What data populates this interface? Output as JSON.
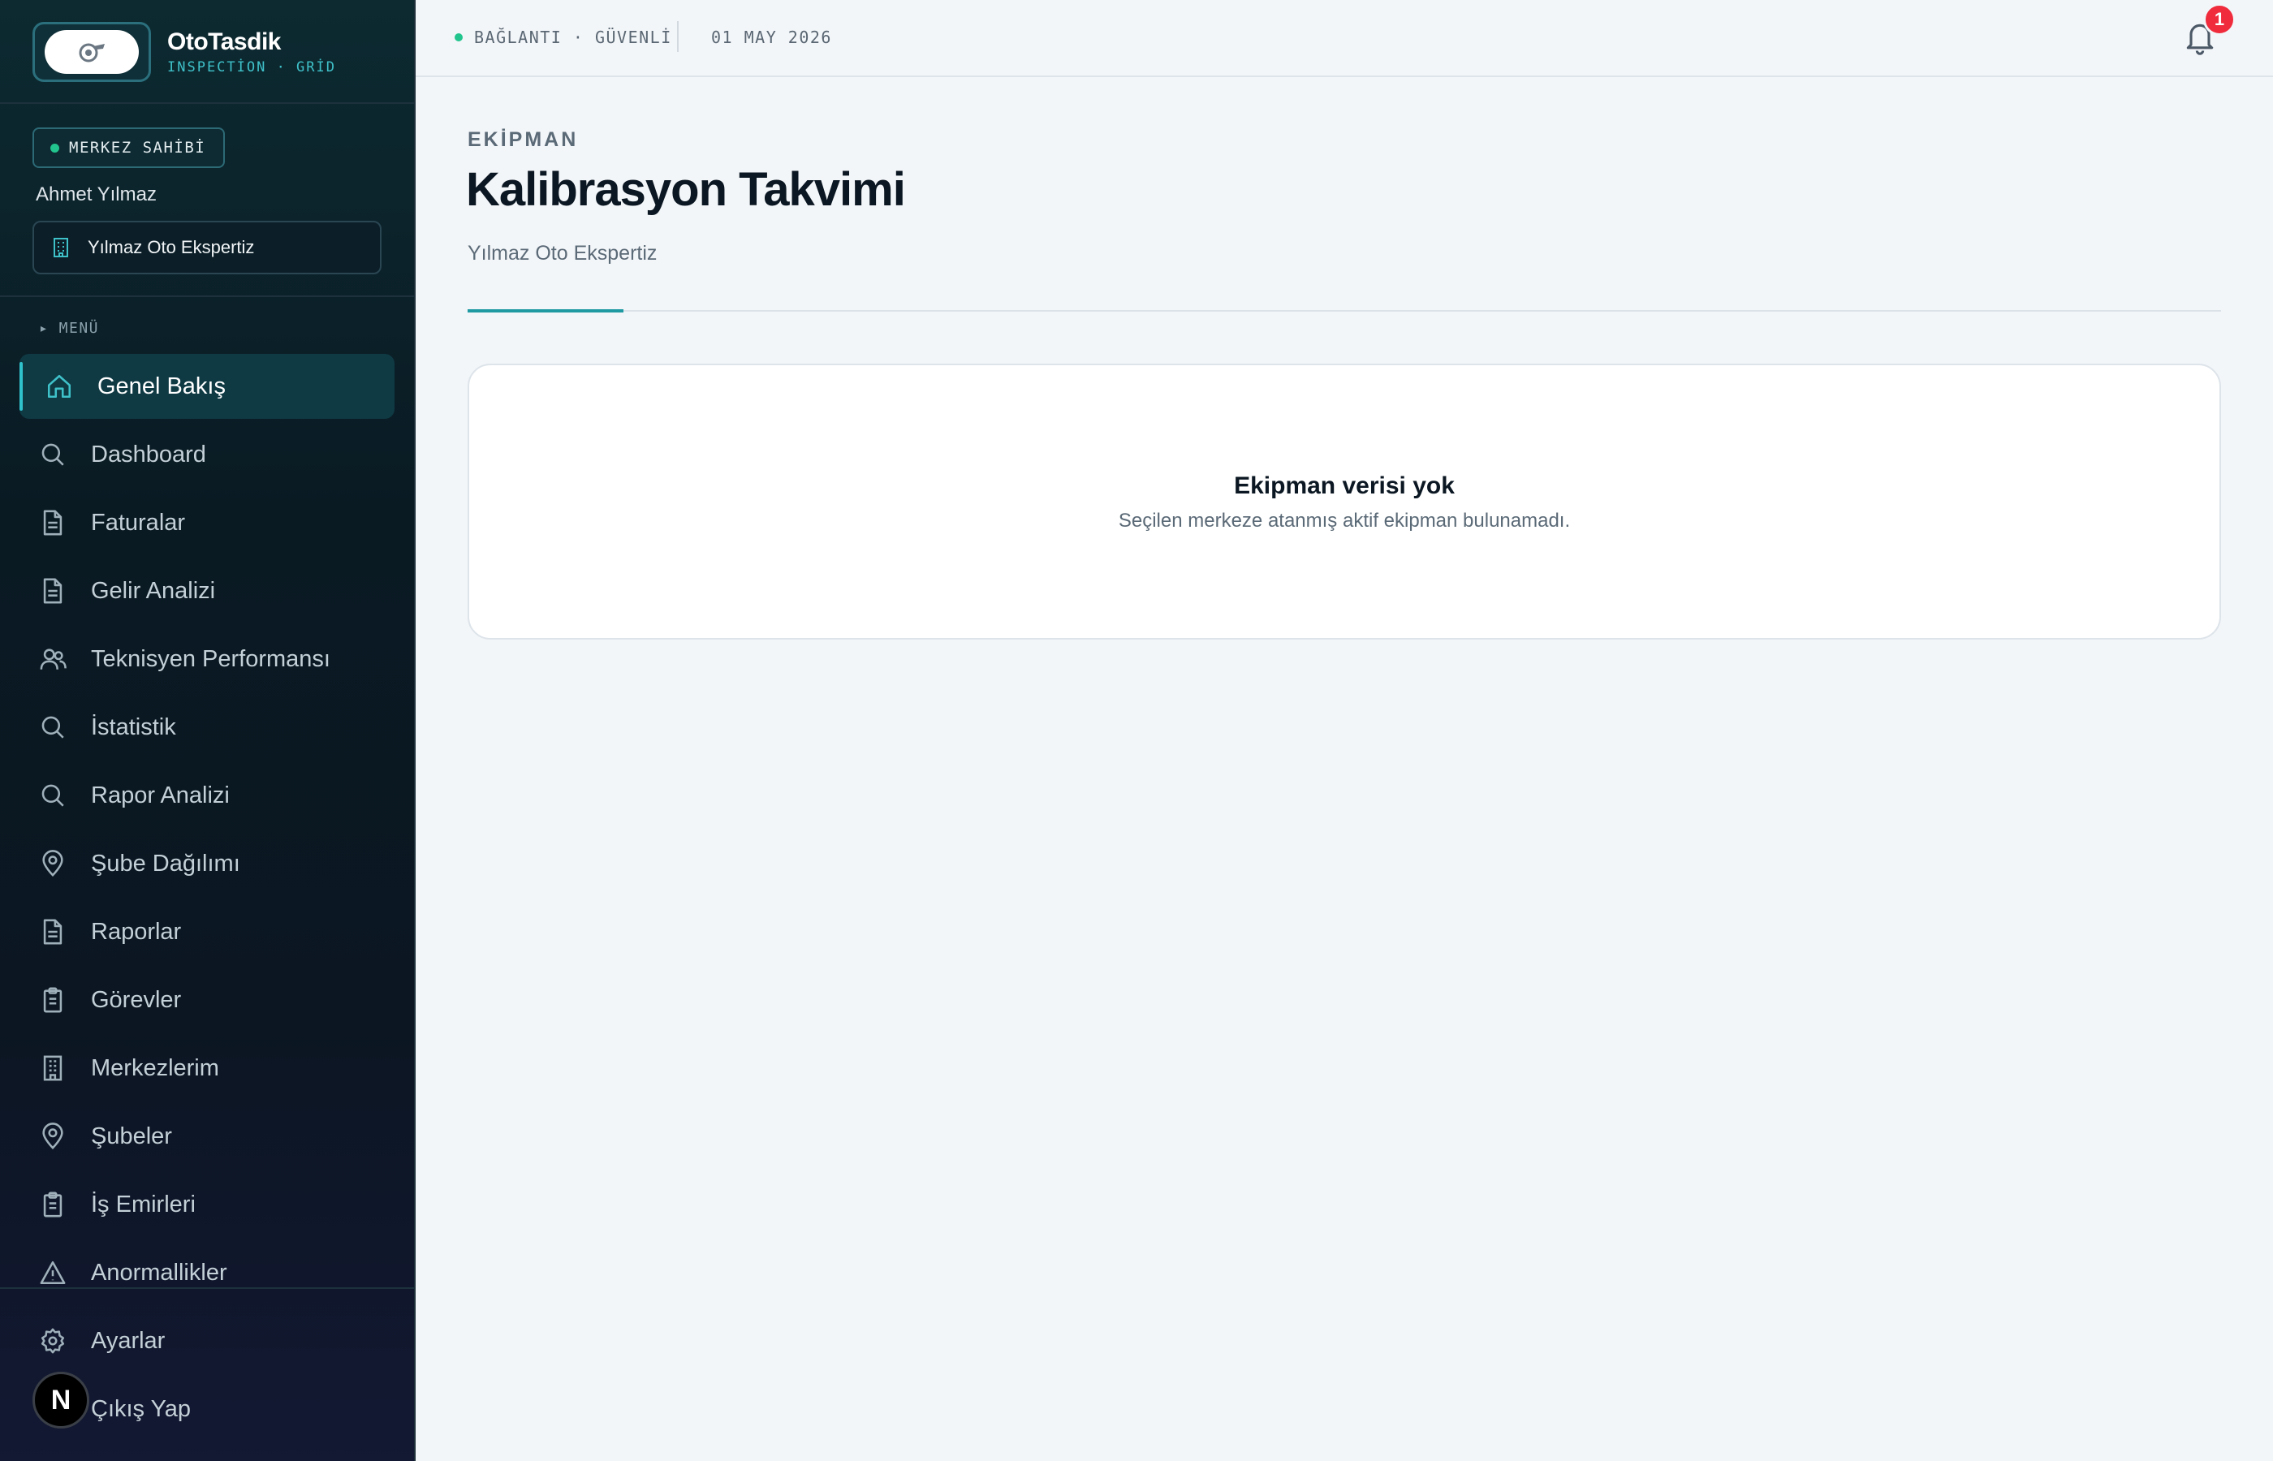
{
  "brand": {
    "name": "OtoTasdik",
    "subtitle": "INSPECTİON · GRİD"
  },
  "user": {
    "role": "MERKEZ SAHİBİ",
    "name": "Ahmet Yılmaz",
    "center": "Yılmaz Oto Ekspertiz"
  },
  "sidebar": {
    "menu_label": "▸ MENÜ",
    "items": [
      {
        "label": "Genel Bakış",
        "icon": "home-icon",
        "active": true
      },
      {
        "label": "Dashboard",
        "icon": "search-icon"
      },
      {
        "label": "Faturalar",
        "icon": "document-icon"
      },
      {
        "label": "Gelir Analizi",
        "icon": "document-icon"
      },
      {
        "label": "Teknisyen Performansı",
        "icon": "users-icon"
      },
      {
        "label": "İstatistik",
        "icon": "search-icon"
      },
      {
        "label": "Rapor Analizi",
        "icon": "search-icon"
      },
      {
        "label": "Şube Dağılımı",
        "icon": "map-pin-icon"
      },
      {
        "label": "Raporlar",
        "icon": "document-icon"
      },
      {
        "label": "Görevler",
        "icon": "clipboard-icon"
      },
      {
        "label": "Merkezlerim",
        "icon": "building-icon"
      },
      {
        "label": "Şubeler",
        "icon": "map-pin-icon"
      },
      {
        "label": "İş Emirleri",
        "icon": "clipboard-icon"
      },
      {
        "label": "Anormallikler",
        "icon": "warning-icon"
      }
    ],
    "bottom": [
      {
        "label": "Ayarlar",
        "icon": "gear-icon"
      },
      {
        "label": "Çıkış Yap",
        "icon": "logout-icon"
      }
    ],
    "avatar_letter": "N"
  },
  "topbar": {
    "connection": "BAĞLANTI · GÜVENLİ",
    "date": "01 MAY 2026",
    "notification_count": "1"
  },
  "main": {
    "eyebrow": "EKİPMAN",
    "title": "Kalibrasyon Takvimi",
    "subtitle": "Yılmaz Oto Ekspertiz",
    "empty_title": "Ekipman verisi yok",
    "empty_desc": "Seçilen merkeze atanmış aktif ekipman bulunamadı."
  },
  "colors": {
    "accent": "#2fc2cc",
    "status_ok": "#22c58e",
    "badge": "#ef2b3c"
  }
}
